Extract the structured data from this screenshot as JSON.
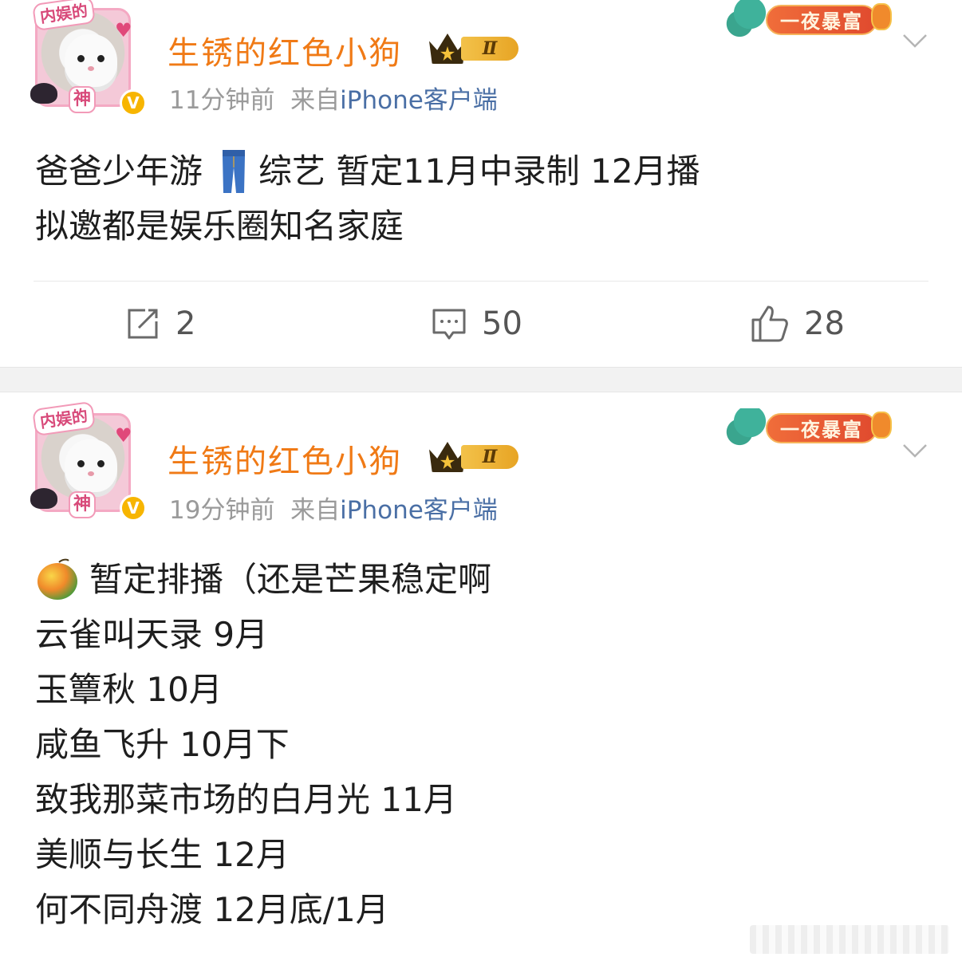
{
  "posts": [
    {
      "author": {
        "name": "生锈的红色小狗",
        "avatar_tag_top": "内娱的",
        "avatar_tag_bottom": "神",
        "vip_level": "Ⅱ"
      },
      "time": "11分钟前",
      "source_prefix": "来自",
      "source": "iPhone客户端",
      "badge_label": "一夜暴富",
      "content": {
        "line1_before": "爸爸少年游",
        "line1_emoji": "jeans-emoji",
        "line1_after": "综艺 暂定11月中录制 12月播",
        "line2": "拟邀都是娱乐圈知名家庭"
      },
      "actions": {
        "repost_count": "2",
        "comment_count": "50",
        "like_count": "28"
      }
    },
    {
      "author": {
        "name": "生锈的红色小狗",
        "avatar_tag_top": "内娱的",
        "avatar_tag_bottom": "神",
        "vip_level": "Ⅱ"
      },
      "time": "19分钟前",
      "source_prefix": "来自",
      "source": "iPhone客户端",
      "badge_label": "一夜暴富",
      "content": {
        "line1_emoji": "mango-emoji",
        "line1_after": "暂定排播（还是芒果稳定啊",
        "lines": [
          "云雀叫天录 9月",
          "玉簟秋 10月",
          "咸鱼飞升 10月下",
          "致我那菜市场的白月光 11月",
          "美顺与长生 12月",
          "何不同舟渡 12月底/1月"
        ]
      }
    }
  ],
  "colors": {
    "username": "#f07a16",
    "meta": "#9a9a9a",
    "source_link": "#4a6fa5",
    "separator": "#f2f2f2",
    "badge": "#e04a2e",
    "verified": "#f7b500"
  },
  "icons": {
    "repost": "repost-icon",
    "comment": "comment-icon",
    "like": "thumbs-up-icon",
    "menu": "chevron-down-icon"
  }
}
